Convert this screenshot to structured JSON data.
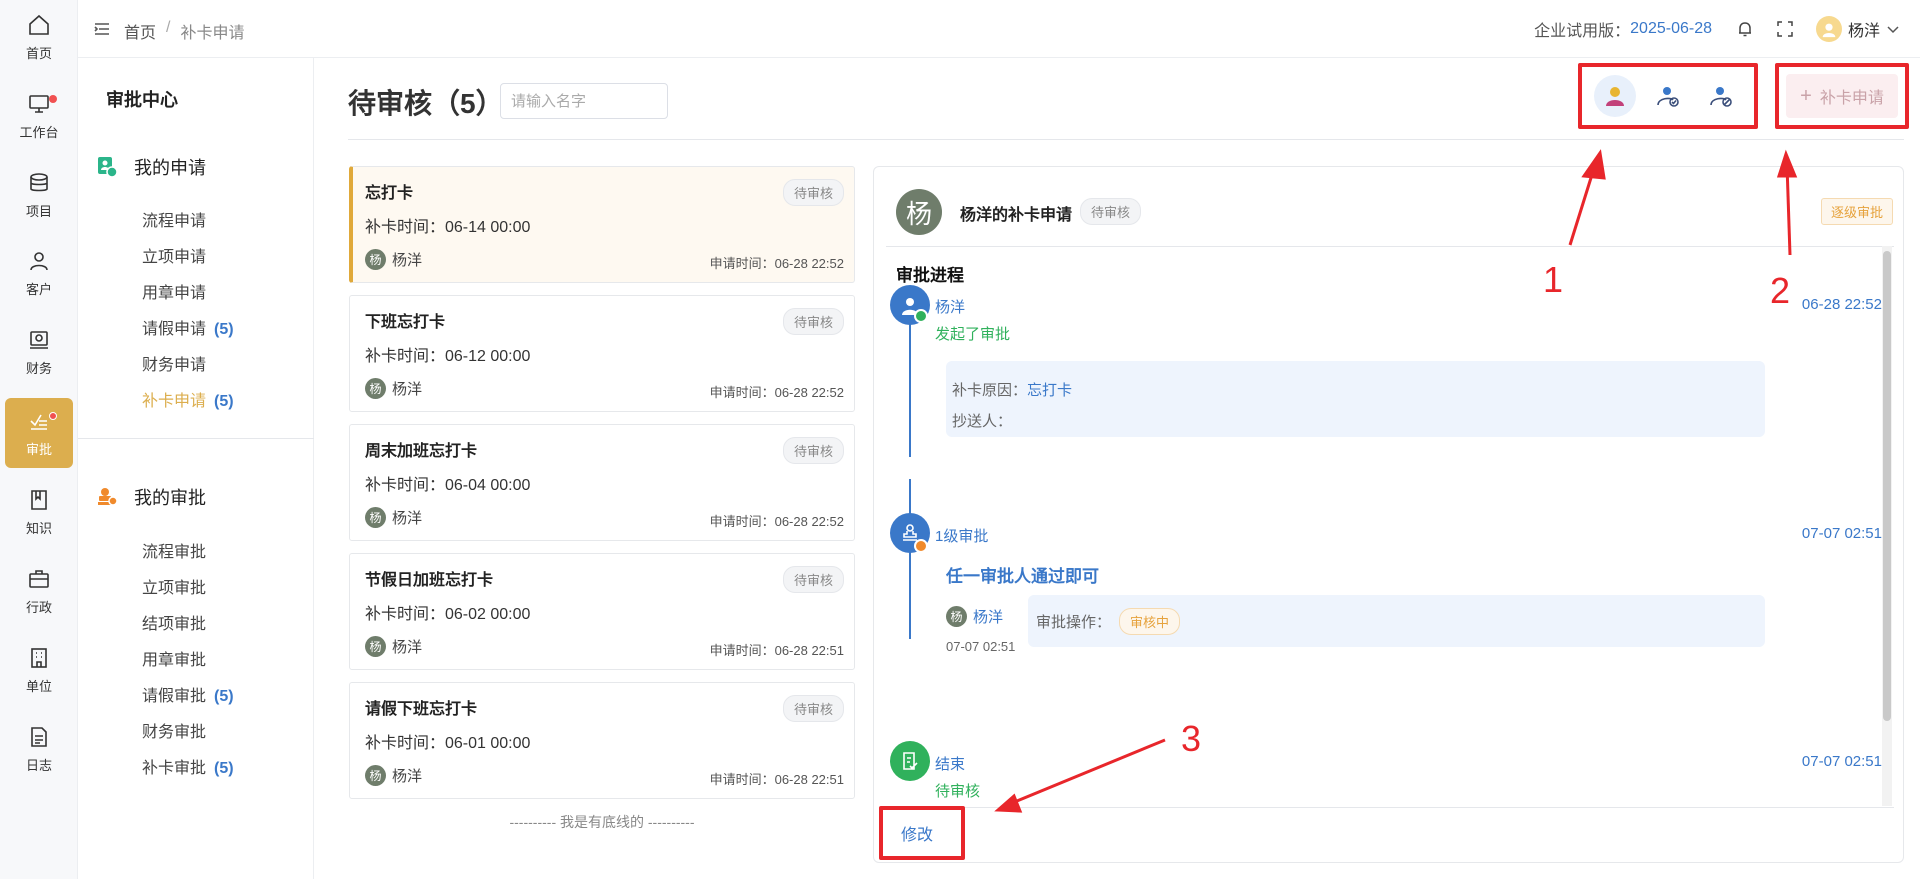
{
  "rail": {
    "items": [
      {
        "label": "首页",
        "icon": "home-icon"
      },
      {
        "label": "工作台",
        "icon": "monitor-icon",
        "dot": true
      },
      {
        "label": "项目",
        "icon": "database-icon"
      },
      {
        "label": "客户",
        "icon": "user-icon"
      },
      {
        "label": "财务",
        "icon": "finance-icon"
      },
      {
        "label": "审批",
        "icon": "approval-icon",
        "dot": true,
        "active": true
      },
      {
        "label": "知识",
        "icon": "book-icon"
      },
      {
        "label": "行政",
        "icon": "briefcase-icon"
      },
      {
        "label": "单位",
        "icon": "building-icon"
      },
      {
        "label": "日志",
        "icon": "document-icon"
      }
    ]
  },
  "topbar": {
    "breadcrumb": {
      "home": "首页",
      "separator": "/",
      "current": "补卡申请"
    },
    "trial_label": "企业试用版：",
    "trial_date": "2025-06-28",
    "user_name": "杨洋"
  },
  "subnav": {
    "title": "审批中心",
    "my_applications": {
      "label": "我的申请",
      "items": [
        {
          "label": "流程申请"
        },
        {
          "label": "立项申请"
        },
        {
          "label": "用章申请"
        },
        {
          "label": "请假申请",
          "count": "(5)"
        },
        {
          "label": "财务申请"
        },
        {
          "label": "补卡申请",
          "count": "(5)",
          "active": true
        }
      ]
    },
    "my_approvals": {
      "label": "我的审批",
      "items": [
        {
          "label": "流程审批"
        },
        {
          "label": "立项审批"
        },
        {
          "label": "结项审批"
        },
        {
          "label": "用章审批"
        },
        {
          "label": "请假审批",
          "count": "(5)"
        },
        {
          "label": "财务审批"
        },
        {
          "label": "补卡审批",
          "count": "(5)"
        }
      ]
    }
  },
  "main": {
    "title": "待审核（5）",
    "search_placeholder": "请输入名字",
    "add_button": "补卡申请",
    "list": [
      {
        "title": "忘打卡",
        "badge": "待审核",
        "time_label": "补卡时间：06-14 00:00",
        "user": "杨洋",
        "avatar": "杨",
        "applied": "申请时间：06-28 22:52",
        "selected": true
      },
      {
        "title": "下班忘打卡",
        "badge": "待审核",
        "time_label": "补卡时间：06-12 00:00",
        "user": "杨洋",
        "avatar": "杨",
        "applied": "申请时间：06-28 22:52"
      },
      {
        "title": "周末加班忘打卡",
        "badge": "待审核",
        "time_label": "补卡时间：06-04 00:00",
        "user": "杨洋",
        "avatar": "杨",
        "applied": "申请时间：06-28 22:52"
      },
      {
        "title": "节假日加班忘打卡",
        "badge": "待审核",
        "time_label": "补卡时间：06-02 00:00",
        "user": "杨洋",
        "avatar": "杨",
        "applied": "申请时间：06-28 22:51"
      },
      {
        "title": "请假下班忘打卡",
        "badge": "待审核",
        "time_label": "补卡时间：06-01 00:00",
        "user": "杨洋",
        "avatar": "杨",
        "applied": "申请时间：06-28 22:51"
      }
    ],
    "list_end": "---------- 我是有底线的 ----------"
  },
  "detail": {
    "avatar": "杨",
    "title": "杨洋的补卡申请",
    "badge": "待审核",
    "tag": "逐级审批",
    "progress_title": "审批进程",
    "start": {
      "name": "杨洋",
      "status": "发起了审批",
      "time": "06-28 22:52"
    },
    "info": {
      "reason_label": "补卡原因：",
      "reason": "忘打卡",
      "cc_label": "抄送人："
    },
    "level1": {
      "name": "1级审批",
      "time": "07-07 02:51",
      "rule": "任一审批人通过即可",
      "approver": "杨洋",
      "approver_avatar": "杨",
      "approver_time": "07-07 02:51",
      "op_label": "审批操作：",
      "op_status": "审核中"
    },
    "end": {
      "name": "结束",
      "status": "待审核",
      "time": "07-07 02:51"
    },
    "edit": "修改"
  },
  "annotations": {
    "labels": [
      "1",
      "2",
      "3"
    ],
    "color": "#e8262b"
  }
}
